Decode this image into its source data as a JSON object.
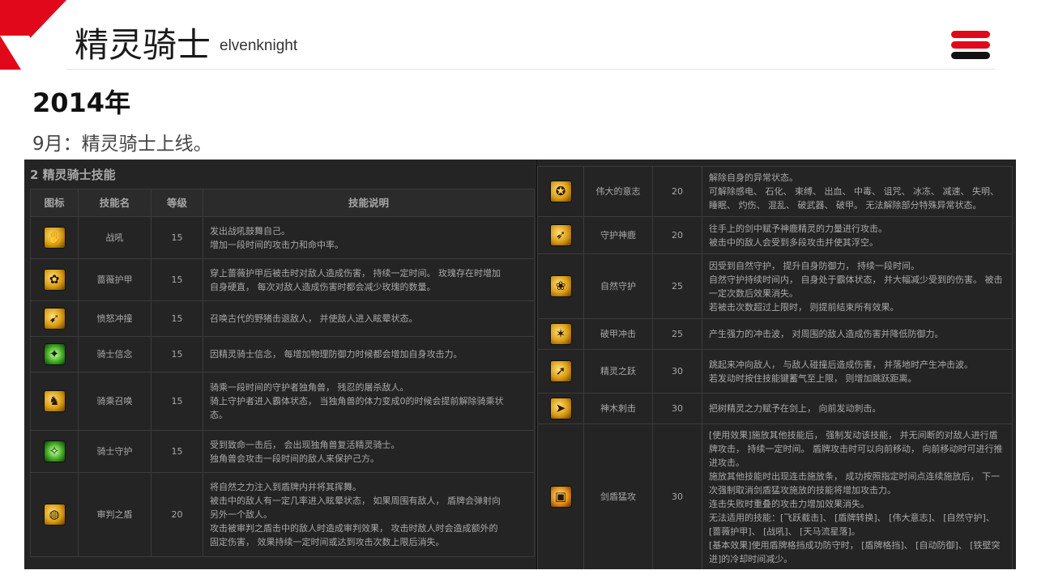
{
  "header": {
    "title": "精灵骑士",
    "title_en": "elvenknight",
    "accent_color": "#e0081a"
  },
  "year": "2014年",
  "event": "9月：精灵骑士上线。",
  "panel": {
    "section_title": "2 精灵骑士技能",
    "columns": [
      "图标",
      "技能名",
      "等级",
      "技能说明"
    ],
    "left_rows": [
      {
        "icon": "battle-cry-icon",
        "name": "战吼",
        "level": "15",
        "desc": [
          "发出战吼鼓舞自己。",
          "增加一段时间的攻击力和命中率。"
        ]
      },
      {
        "icon": "rose-armor-icon",
        "name": "蔷薇护甲",
        "level": "15",
        "desc": [
          "穿上蔷薇护甲后被击时对敌人造成伤害， 持续一定时间。 玫瑰存在时增加",
          "自身硬直， 每次对敌人造成伤害时都会减少玫瑰的数量。"
        ]
      },
      {
        "icon": "rage-charge-icon",
        "name": "愤怒冲撞",
        "level": "15",
        "desc": [
          "召唤古代的野猪击退敌人， 并使敌人进入眩晕状态。"
        ]
      },
      {
        "icon": "knight-faith-icon",
        "name": "骑士信念",
        "level": "15",
        "desc": [
          "因精灵骑士信念， 每增加物理防御力时候都会增加自身攻击力。"
        ]
      },
      {
        "icon": "mount-summon-icon",
        "name": "骑乘召唤",
        "level": "15",
        "desc": [
          "骑乘一段时间的守护者独角兽， 残忍的屠杀敌人。",
          "骑上守护者进入霸体状态， 当独角兽的体力变成0的时候会提前解除骑乘状",
          "态。"
        ]
      },
      {
        "icon": "knight-guard-icon",
        "name": "骑士守护",
        "level": "15",
        "desc": [
          "受到致命一击后， 会出现独角兽复活精灵骑士。",
          "独角兽会攻击一段时间的敌人来保护己方。"
        ]
      },
      {
        "icon": "judgment-shield-icon",
        "name": "审判之盾",
        "level": "20",
        "desc": [
          "将自然之力注入到盾牌内并将其挥舞。",
          "被击中的敌人有一定几率进入眩晕状态， 如果周围有敌人， 盾牌会弹射向",
          "另外一个敌人。",
          "攻击被审判之盾击中的敌人时造成审判效果， 攻击时敌人时会造成额外的",
          "固定伤害， 效果持续一定时间或达到攻击次数上限后消失。"
        ]
      }
    ],
    "right_rows": [
      {
        "icon": "great-will-icon",
        "name": "伟大的意志",
        "level": "20",
        "desc": [
          "解除自身的异常状态。",
          "可解除感电、 石化、 束缚、 出血、 中毒、 诅咒、 冰冻、 减速、 失明、",
          "睡眠、 灼伤、 混乱、 破武器、 破甲。 无法解除部分特殊异常状态。"
        ]
      },
      {
        "icon": "guardian-deer-icon",
        "name": "守护神鹿",
        "level": "20",
        "desc": [
          "往手上的剑中赋予神鹿精灵的力量进行攻击。",
          "被击中的敌人会受到多段攻击并使其浮空。"
        ]
      },
      {
        "icon": "nature-guard-icon",
        "name": "自然守护",
        "level": "25",
        "desc": [
          "因受到自然守护， 提升自身防御力， 持续一段时间。",
          "自然守护持续时间内， 自身处于霸体状态， 并大幅减少受到的伤害。 被击",
          "一定次数后效果消失。",
          "若被击次数超过上限时， 则提前结束所有效果。"
        ]
      },
      {
        "icon": "armor-break-icon",
        "name": "破甲冲击",
        "level": "25",
        "desc": [
          "产生强力的冲击波， 对周围的敌人造成伤害并降低防御力。"
        ]
      },
      {
        "icon": "elf-leap-icon",
        "name": "精灵之跃",
        "level": "30",
        "desc": [
          "跳起来冲向敌人， 与敌人碰撞后造成伤害， 并落地时产生冲击波。",
          "若发动时按住技能键蓄气至上限， 则增加跳跃距离。"
        ]
      },
      {
        "icon": "divine-tree-strike-icon",
        "name": "神木刺击",
        "level": "30",
        "desc": [
          "把树精灵之力赋予在剑上， 向前发动刺击。"
        ]
      },
      {
        "icon": "sword-shield-icon",
        "name": "剑盾猛攻",
        "level": "30",
        "desc": [
          "[使用效果]施放其他技能后， 强制发动该技能， 并无间断的对敌人进行盾",
          "牌攻击， 持续一定时间。 盾牌攻击时可以向前移动， 向前移动时可进行推",
          "进攻击。",
          "施放其他技能时出现连击施放条， 成功按照指定时间点连续施放后， 下一",
          "次强制取消剑盾猛攻施放的技能将增加攻击力。",
          "连击失败时重叠的攻击力增加效果消失。",
          "无法适用的技能：[飞跃截击]、 [盾牌转换]、 [伟大意志]、 [自然守护]、",
          "[蔷薇护甲]、 [战吼]、 [天马流星落]。",
          "[基本效果]使用盾牌格挡成功防守时， [盾牌格挡]、 [自动防御]、 [铁壁突",
          "进]的冷却时间减少。"
        ]
      }
    ]
  }
}
